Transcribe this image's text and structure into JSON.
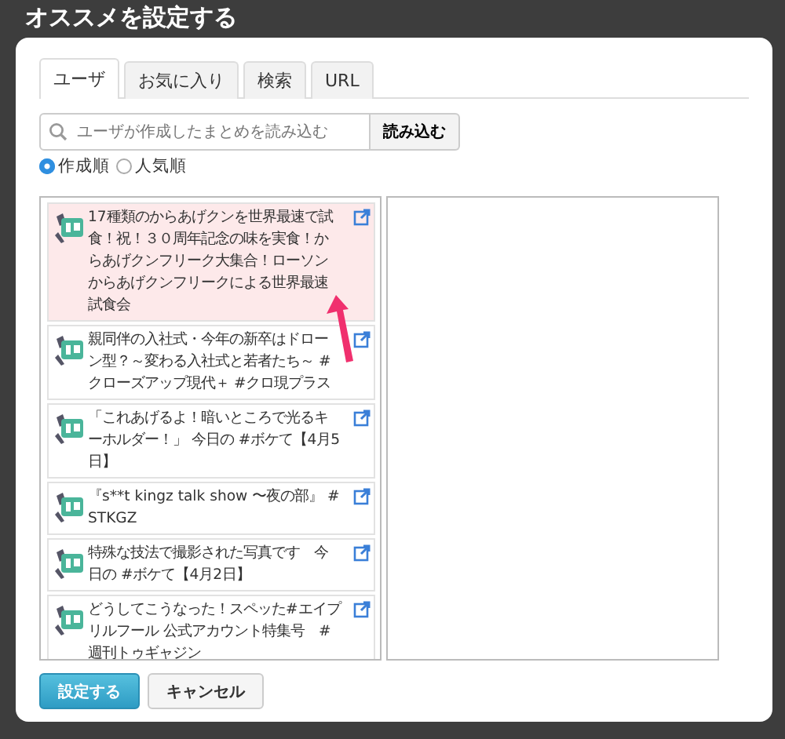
{
  "dialog": {
    "title": "オススメを設定する"
  },
  "tabs": [
    {
      "label": "ユーザ",
      "selected": true
    },
    {
      "label": "お気に入り",
      "selected": false
    },
    {
      "label": "検索",
      "selected": false
    },
    {
      "label": "URL",
      "selected": false
    }
  ],
  "search": {
    "placeholder": "ユーザが作成したまとめを読み込む",
    "button": "読み込む"
  },
  "sort": [
    {
      "label": "作成順",
      "selected": true
    },
    {
      "label": "人気順",
      "selected": false
    }
  ],
  "items": [
    {
      "text": "17種類のからあげクンを世界最速で試食！祝！３０周年記念の味を実食！からあげクンフリーク大集合！ローソンからあげクンフリークによる世界最速試食会",
      "selected": true
    },
    {
      "text": "親同伴の入社式・今年の新卒はドローン型？～変わる入社式と若者たち～ #クローズアップ現代＋ #クロ現プラス",
      "selected": false
    },
    {
      "text": "「これあげるよ！暗いところで光るキーホルダー！」 今日の #ボケて【4月5日】",
      "selected": false
    },
    {
      "text": "『s**t kingz talk show 〜夜の部』 #STKGZ",
      "selected": false
    },
    {
      "text": "特殊な技法で撮影された写真です　今日の #ボケて【4月2日】",
      "selected": false
    },
    {
      "text": "どうしてこうなった！スペッた#エイプリルフール 公式アカウント特集号　#週刊トゥギャジン",
      "selected": false
    }
  ],
  "buttons": {
    "confirm": "設定する",
    "cancel": "キャンセル"
  }
}
